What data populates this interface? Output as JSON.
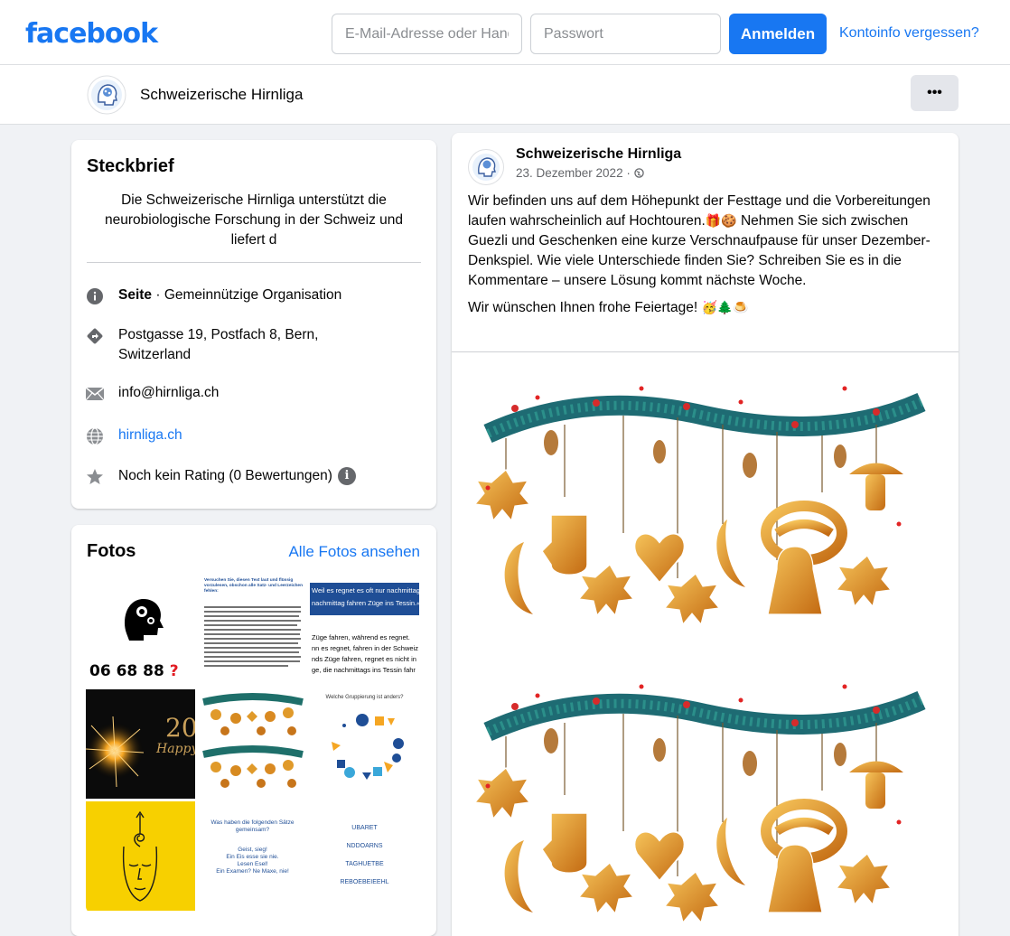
{
  "topbar": {
    "logo": "facebook",
    "email_placeholder": "E-Mail-Adresse oder Handynummer",
    "password_placeholder": "Passwort",
    "login_label": "Anmelden",
    "forgot_label": "Kontoinfo vergessen?"
  },
  "pagebar": {
    "name": "Schweizerische Hirnliga",
    "more_label": "•••"
  },
  "about": {
    "title": "Steckbrief",
    "description": "Die Schweizerische Hirnliga unterstützt die neurobiologische Forschung in der Schweiz und liefert d",
    "category_bold": "Seite",
    "category_rest": " · Gemeinnützige Organisation",
    "address": "Postgasse 19, Postfach 8, Bern, Switzerland",
    "email": "info@hirnliga.ch",
    "website": "hirnliga.ch",
    "rating": "Noch kein Rating (0 Bewertungen)"
  },
  "photos": {
    "title": "Fotos",
    "see_all": "Alle Fotos ansehen",
    "tiles": {
      "numbers": "06 68 88",
      "qmark": "? ",
      "text_heading": "Versuchen Sie, diesen Text laut und flüssig vorzulesen, obschon alle Satz- und Leerzeichen fehlen:",
      "rain_1": "Weil es regnet es oft nur nachmittags",
      "rain_2": "nachmittag fahren Züge ins Tessin.«",
      "rain_3": "Züge fahren, während es regnet.",
      "rain_4": "nn es regnet, fahren in der Schweiz",
      "rain_5": "nds Züge fahren, regnet es nicht in",
      "rain_6": "ge, die nachmittags ins Tessin fahr",
      "fireworks_text": "20",
      "fireworks_script": "Happy",
      "grouping_title": "Welche Gruppierung ist anders?",
      "sentences_title": "Was haben die folgenden Sätze gemeinsam?",
      "sentences_1": "Geist, sieg!",
      "sentences_2": "Ein Eis esse sie nie.",
      "sentences_3": "Lesen Esel!",
      "sentences_4": "Ein Examen? Ne Maxe, nie!",
      "anagram_1": "UBARET",
      "anagram_2": "NDDOARNS",
      "anagram_3": "TAGHUETBE",
      "anagram_4": "REBOEBEIEEHL"
    }
  },
  "post": {
    "author": "Schweizerische Hirnliga",
    "date": "23. Dezember 2022 · ",
    "globe_icon": "globe-icon",
    "paragraph1": "Wir befinden uns auf dem Höhepunkt der Festtage und die Vorbereitungen laufen wahrscheinlich auf Hochtouren.",
    "paragraph1_emoji": "🎁🍪",
    "paragraph1_cont": "Nehmen Sie sich zwischen Guezli und Geschenken eine kurze Verschnaufpause für unser Dezember-Denkspiel. Wie viele Unterschiede finden Sie? Schreiben Sie es in die Kommentare – unsere Lösung kommt nächste Woche.",
    "paragraph2": "Wir wünschen Ihnen frohe Feiertage! ",
    "paragraph2_emoji": "🥳🌲🍮"
  },
  "colors": {
    "brand": "#1877f2",
    "background": "#f0f2f5",
    "secondary_text": "#65676b"
  }
}
